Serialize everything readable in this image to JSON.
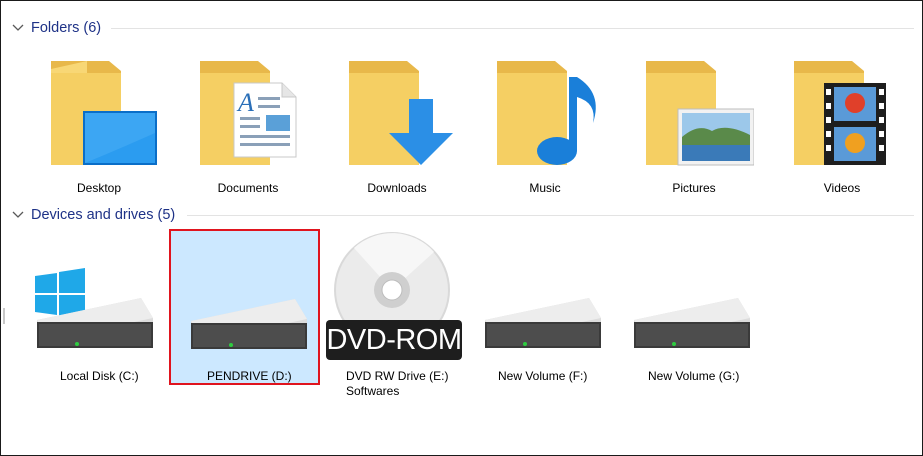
{
  "groups": {
    "folders": {
      "title": "Folders (6)"
    },
    "drives": {
      "title": "Devices and drives (5)"
    }
  },
  "folders": [
    {
      "label": "Desktop",
      "icon": "desktop-folder-icon"
    },
    {
      "label": "Documents",
      "icon": "documents-folder-icon"
    },
    {
      "label": "Downloads",
      "icon": "downloads-folder-icon"
    },
    {
      "label": "Music",
      "icon": "music-folder-icon"
    },
    {
      "label": "Pictures",
      "icon": "pictures-folder-icon"
    },
    {
      "label": "Videos",
      "icon": "videos-folder-icon"
    }
  ],
  "drives": [
    {
      "label": "Local Disk (C:)",
      "icon": "windows-drive-icon"
    },
    {
      "label": "PENDRIVE (D:)",
      "icon": "hard-drive-icon",
      "selected": true
    },
    {
      "label": "DVD RW Drive (E:)",
      "sublabel": "Softwares",
      "icon": "dvd-drive-icon",
      "badge": "DVD-ROM"
    },
    {
      "label": "New Volume  (F:)",
      "icon": "hard-drive-icon"
    },
    {
      "label": "New Volume (G:)",
      "icon": "hard-drive-icon"
    }
  ],
  "colors": {
    "group_title": "#1e3287",
    "selection_fill": "#cce8ff",
    "selection_border": "#e0141e",
    "folder_yellow": "#f8d775",
    "accent_blue": "#0a78d7"
  }
}
